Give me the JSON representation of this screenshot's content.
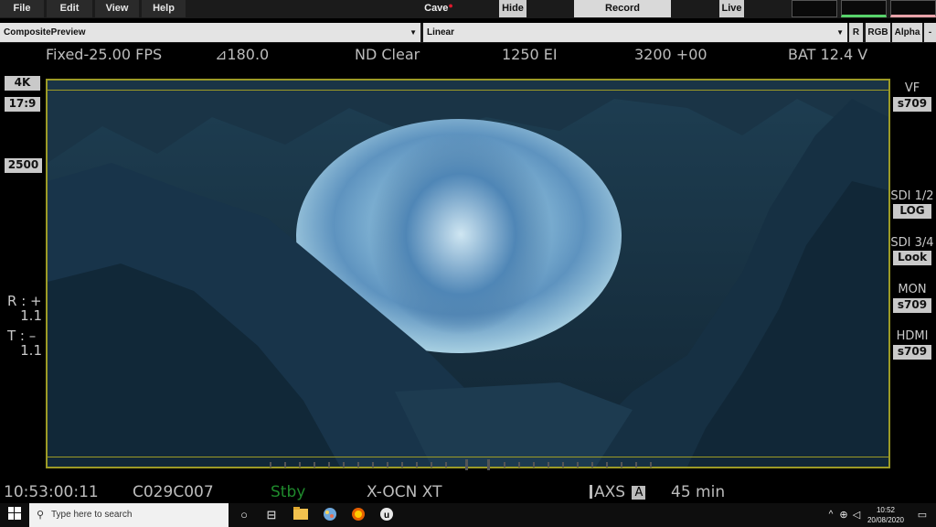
{
  "menu": {
    "file": "File",
    "edit": "Edit",
    "view": "View",
    "help": "Help"
  },
  "title": "Cave",
  "title_dot": "●",
  "buttons": {
    "hide": "Hide",
    "record": "Record",
    "live": "Live"
  },
  "toolbar": {
    "composite": "CompositePreview",
    "lut": "Linear",
    "r": "R",
    "rgb": "RGB",
    "alpha": "Alpha",
    "minus": "-"
  },
  "status_top": {
    "fps": "Fixed-25.00 FPS",
    "shutter": "⊿180.0",
    "nd": "ND Clear",
    "ei": "1250 EI",
    "wb": "3200 +00",
    "battery": "BAT 12.4 V"
  },
  "left_side": {
    "resolution": "4K",
    "aspect": "17:9",
    "iso": "2500",
    "r_label": "R : +",
    "r_value": "1.1",
    "t_label": "T : –",
    "t_value": "1.1"
  },
  "right_side": {
    "vf_label": "VF",
    "vf_value": "s709",
    "sdi12_label": "SDI 1/2",
    "sdi12_value": "LOG",
    "sdi34_label": "SDI 3/4",
    "sdi34_value": "Look",
    "mon_label": "MON",
    "mon_value": "s709",
    "hdmi_label": "HDMI",
    "hdmi_value": "s709"
  },
  "status_bottom": {
    "timecode": "10:53:00:11",
    "clip": "C029C007",
    "state": "Stby",
    "codec": "X-OCN XT",
    "media": "AXS",
    "media_slot": "A",
    "remaining": "45 min"
  },
  "taskbar": {
    "search_placeholder": "Type here to search",
    "time": "10:52",
    "date": "20/08/2020"
  },
  "colors": {
    "frame_line": "#9c9a26",
    "state_green": "#1f8a2c",
    "title_dot": "#e0192c"
  },
  "icons": [
    "windows-start-icon",
    "search-icon",
    "cortana-icon",
    "task-view-icon",
    "file-explorer-icon",
    "paint-icon",
    "firefox-icon",
    "unreal-engine-icon",
    "wifi-icon",
    "volume-icon",
    "notification-icon"
  ]
}
